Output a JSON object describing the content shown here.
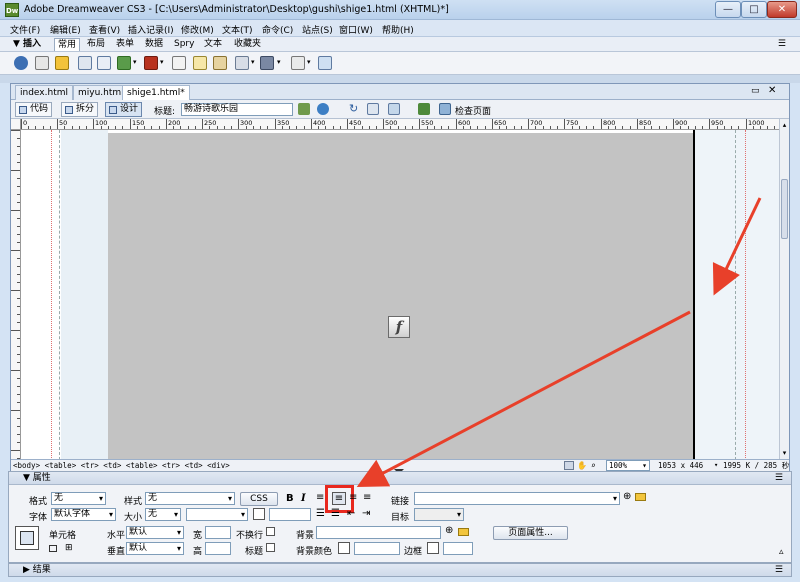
{
  "window": {
    "title": "Adobe Dreamweaver CS3 - [C:\\Users\\Administrator\\Desktop\\gushi\\shige1.html (XHTML)*]",
    "app_icon": "Dw",
    "minimize": "—",
    "maximize": "□",
    "close": "✕"
  },
  "menu": [
    "文件(F)",
    "编辑(E)",
    "查看(V)",
    "插入记录(I)",
    "修改(M)",
    "文本(T)",
    "命令(C)",
    "站点(S)",
    "窗口(W)",
    "帮助(H)"
  ],
  "insert_bar": {
    "tabs": [
      "▼ 插入",
      "常用",
      "布局",
      "表单",
      "数据",
      "Spry",
      "文本",
      "收藏夹"
    ],
    "active_tab": "常用"
  },
  "document": {
    "tabs": [
      "index.html",
      "miyu.html",
      "shige1.html*"
    ],
    "active_tab": "shige1.html*",
    "view_buttons": [
      "代码",
      "拆分",
      "设计"
    ],
    "active_view": "设计",
    "title_label": "标题:",
    "title_value": "畅游诗歌乐园",
    "check_page": "检查页面",
    "ruler_ticks": [
      "0",
      "50",
      "100",
      "150",
      "200",
      "250",
      "300",
      "350",
      "400",
      "450",
      "500",
      "550",
      "600",
      "650",
      "700",
      "750",
      "800",
      "850",
      "900",
      "950",
      "1000"
    ],
    "tag_selector": "<body> <table> <tr> <td> <table> <tr> <td> <div>",
    "zoom": "100%",
    "dimensions": "1053 x 446",
    "file_size": "1995 K / 285 秒",
    "flash_icon": "f"
  },
  "properties": {
    "header": "▼ 属性",
    "format_label": "格式",
    "format_value": "无",
    "style_label": "样式",
    "style_value": "无",
    "css_button": "CSS",
    "bold": "B",
    "italic": "I",
    "link_label": "链接",
    "font_label": "字体",
    "font_value": "默认字体",
    "size_label": "大小",
    "size_value": "无",
    "target_label": "目标",
    "cell_label": "单元格",
    "horz_label": "水平",
    "horz_value": "默认",
    "vert_label": "垂直",
    "vert_value": "默认",
    "width_label": "宽",
    "height_label": "高",
    "nowrap_label": "不换行",
    "header_label": "标题",
    "bg_label": "背景",
    "bgcolor_label": "背景颜色",
    "border_label": "边框",
    "page_props_button": "页面属性..."
  },
  "results": {
    "header": "▶ 结果"
  },
  "colors": {
    "highlight": "#e8281e",
    "flash_bg": "#c3c3c3",
    "arrow": "#e8402a"
  }
}
